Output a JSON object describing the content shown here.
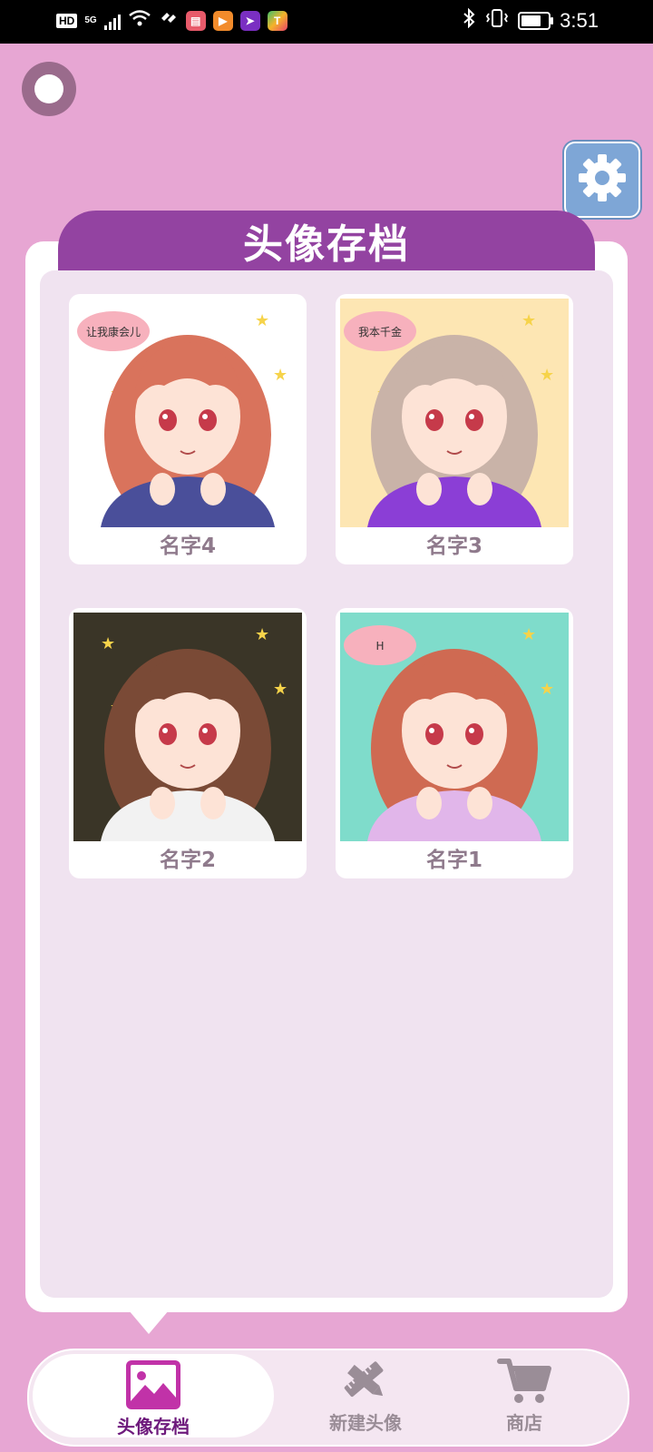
{
  "status_bar": {
    "hd": "HD",
    "network": "5G",
    "time": "3:51",
    "battery_level": 0.85
  },
  "panel": {
    "title": "头像存档"
  },
  "avatars": [
    {
      "name": "名字4",
      "thumb_text": "让我康会儿",
      "bg": "#ffffff",
      "hair": "#d9735c",
      "outfit": "#4a4f9a"
    },
    {
      "name": "名字3",
      "thumb_text": "我本千金",
      "bg": "#fde6b3",
      "hair": "#c9b3a8",
      "outfit": "#8b3ed6"
    },
    {
      "name": "名字2",
      "thumb_text": "",
      "bg": "#3a3527",
      "hair": "#7a4a36",
      "outfit": "#f2f2f2"
    },
    {
      "name": "名字1",
      "thumb_text": "H",
      "bg": "#7fdccb",
      "hair": "#cf6a52",
      "outfit": "#e1b6ea"
    }
  ],
  "bottom_nav": [
    {
      "label": "头像存档",
      "icon": "image-icon",
      "active": true
    },
    {
      "label": "新建头像",
      "icon": "pencil-ruler-icon",
      "active": false
    },
    {
      "label": "商店",
      "icon": "shopping-cart-icon",
      "active": false
    }
  ],
  "colors": {
    "background": "#e7a6d3",
    "panel_header": "#9343a1",
    "panel_inner": "#f0e3f0",
    "settings_button": "#7ea6d6",
    "active_nav_icon": "#c132a8",
    "inactive_nav_icon": "#9a8d97"
  }
}
